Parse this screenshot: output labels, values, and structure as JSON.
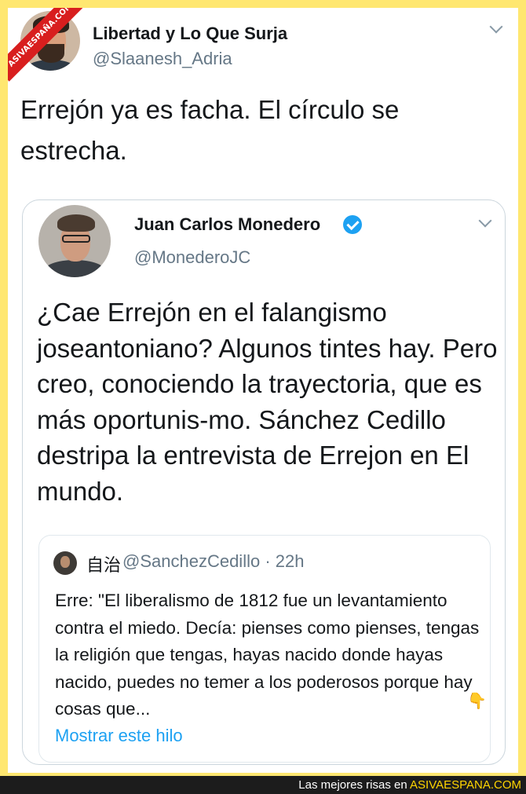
{
  "watermark": "ASIVAESPAÑA.COM",
  "tweet": {
    "author_name": "Libertad y Lo Que Surja",
    "author_handle": "@Slaanesh_Adria",
    "text": "Errejón ya es facha. El círculo se estrecha.",
    "menu_icon": "chevron-down-icon"
  },
  "quoted_tweet": {
    "author_name": "Juan Carlos Monedero",
    "verified_icon": "verified-badge-icon",
    "author_handle": "@MonederoJC",
    "text": "¿Cae Errejón en el falangismo joseantoniano? Algunos tintes hay. Pero creo, conociendo la trayectoria, que es más oportunis-mo. Sánchez Cedillo destripa la entrevista de Errejon en El mundo.",
    "menu_icon": "chevron-down-icon",
    "nested_tweet": {
      "author_name": "自治",
      "author_handle": "@SanchezCedillo · 22h",
      "text": "Erre: \"El liberalismo de 1812 fue un levantamiento contra el miedo. Decía: pienses como pienses, tengas la religión que tengas, hayas nacido donde hayas nacido, puedes no temer a los poderosos porque hay cosas que...",
      "emoji": "👇",
      "link_text": "Mostrar este hilo"
    }
  },
  "footer": {
    "prefix": "Las mejores risas en ",
    "brand": "ASIVAESPANA.COM"
  },
  "colors": {
    "frame": "#ffe770",
    "link": "#1da1f2",
    "secondary_text": "#657786",
    "watermark": "#d81e1e"
  }
}
